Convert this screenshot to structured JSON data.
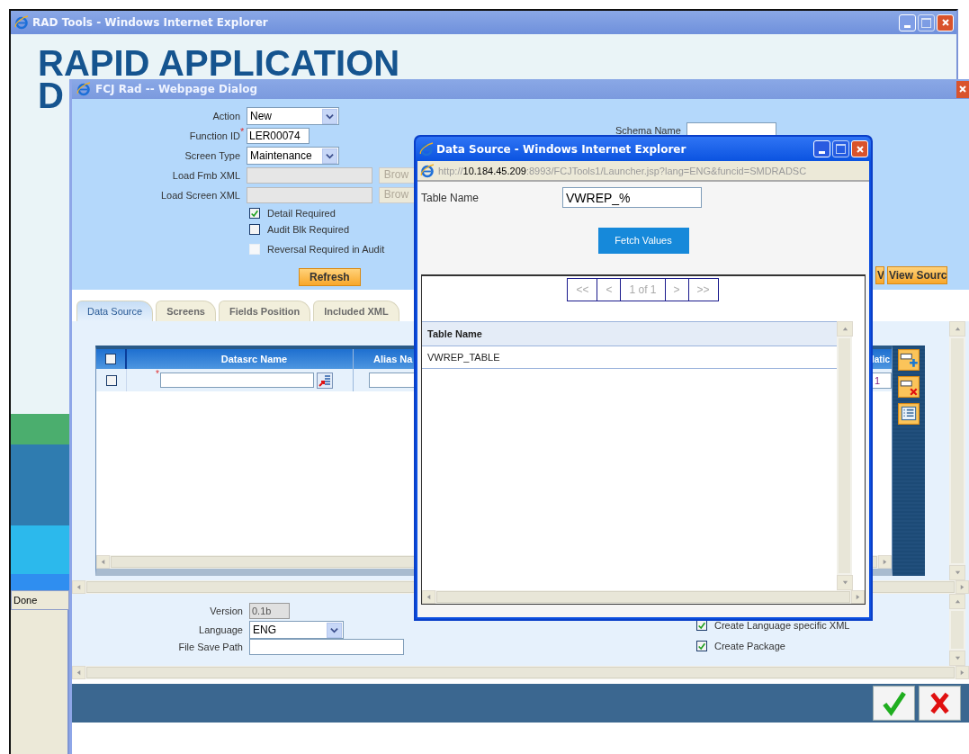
{
  "browser_window": {
    "title": "RAD Tools - Windows Internet Explorer",
    "banner_lines": [
      "RAPID APPLICATION",
      "D"
    ],
    "status": "Done"
  },
  "dialog": {
    "title": "FCJ Rad -- Webpage Dialog",
    "form": {
      "fields": [
        {
          "kind": "select",
          "label": "Action",
          "value": "New"
        },
        {
          "kind": "text",
          "label": "Function ID",
          "value": "LER00074",
          "required_mark": "*"
        },
        {
          "kind": "select",
          "label": "Screen Type",
          "value": "Maintenance"
        },
        {
          "kind": "file",
          "label": "Load Fmb XML",
          "button": "Brow"
        },
        {
          "kind": "file",
          "label": "Load Screen XML",
          "button": "Brow"
        }
      ],
      "checkboxes": [
        {
          "label": "Detail Required",
          "checked": true,
          "disabled": false
        },
        {
          "label": "Audit Blk Required",
          "checked": false,
          "disabled": false
        },
        {
          "label": "Reversal Required in Audit",
          "checked": false,
          "disabled": true
        }
      ],
      "refresh_button": "Refresh",
      "schema_name_label": "Schema Name",
      "right_buttons": [
        "V",
        "View Sourc"
      ]
    },
    "tabs": [
      {
        "label": "Data Source",
        "selected": true
      },
      {
        "label": "Screens",
        "selected": false
      },
      {
        "label": "Fields Position",
        "selected": false
      },
      {
        "label": "Included XML",
        "selected": false
      }
    ],
    "grid": {
      "columns": [
        "Datasrc Name",
        "Alias Na",
        "latic"
      ],
      "header_checked": false,
      "rows": [
        {
          "checked": false,
          "required_mark": "*",
          "column_3": "1"
        }
      ]
    },
    "footer": {
      "version": {
        "label": "Version",
        "value": "0.1b"
      },
      "language": {
        "label": "Language",
        "value": "ENG"
      },
      "file_save_path": {
        "label": "File Save Path"
      },
      "options": [
        {
          "label": "Create Language specific XML",
          "checked": true
        },
        {
          "label": "Create Package",
          "checked": true
        }
      ]
    }
  },
  "popup": {
    "title": "Data Source - Windows Internet Explorer",
    "address": [
      {
        "text": "http://",
        "emphasis": false
      },
      {
        "text": "10.184.45.209",
        "emphasis": true
      },
      {
        "text": ":8993/FCJTools1/Launcher.jsp?lang=ENG&funcid=SMDRADSC",
        "emphasis": false
      }
    ],
    "table_name": {
      "label": "Table Name",
      "value": "VWREP_%"
    },
    "fetch_button": "Fetch Values",
    "pager": [
      {
        "label": "<<",
        "disabled": true
      },
      {
        "label": "<",
        "disabled": true
      },
      {
        "label": "1 of 1",
        "disabled": true
      },
      {
        "label": ">",
        "disabled": true
      },
      {
        "label": ">>",
        "disabled": true
      }
    ],
    "results": {
      "column": "Table Name",
      "rows": [
        "VWREP_TABLE"
      ]
    }
  }
}
